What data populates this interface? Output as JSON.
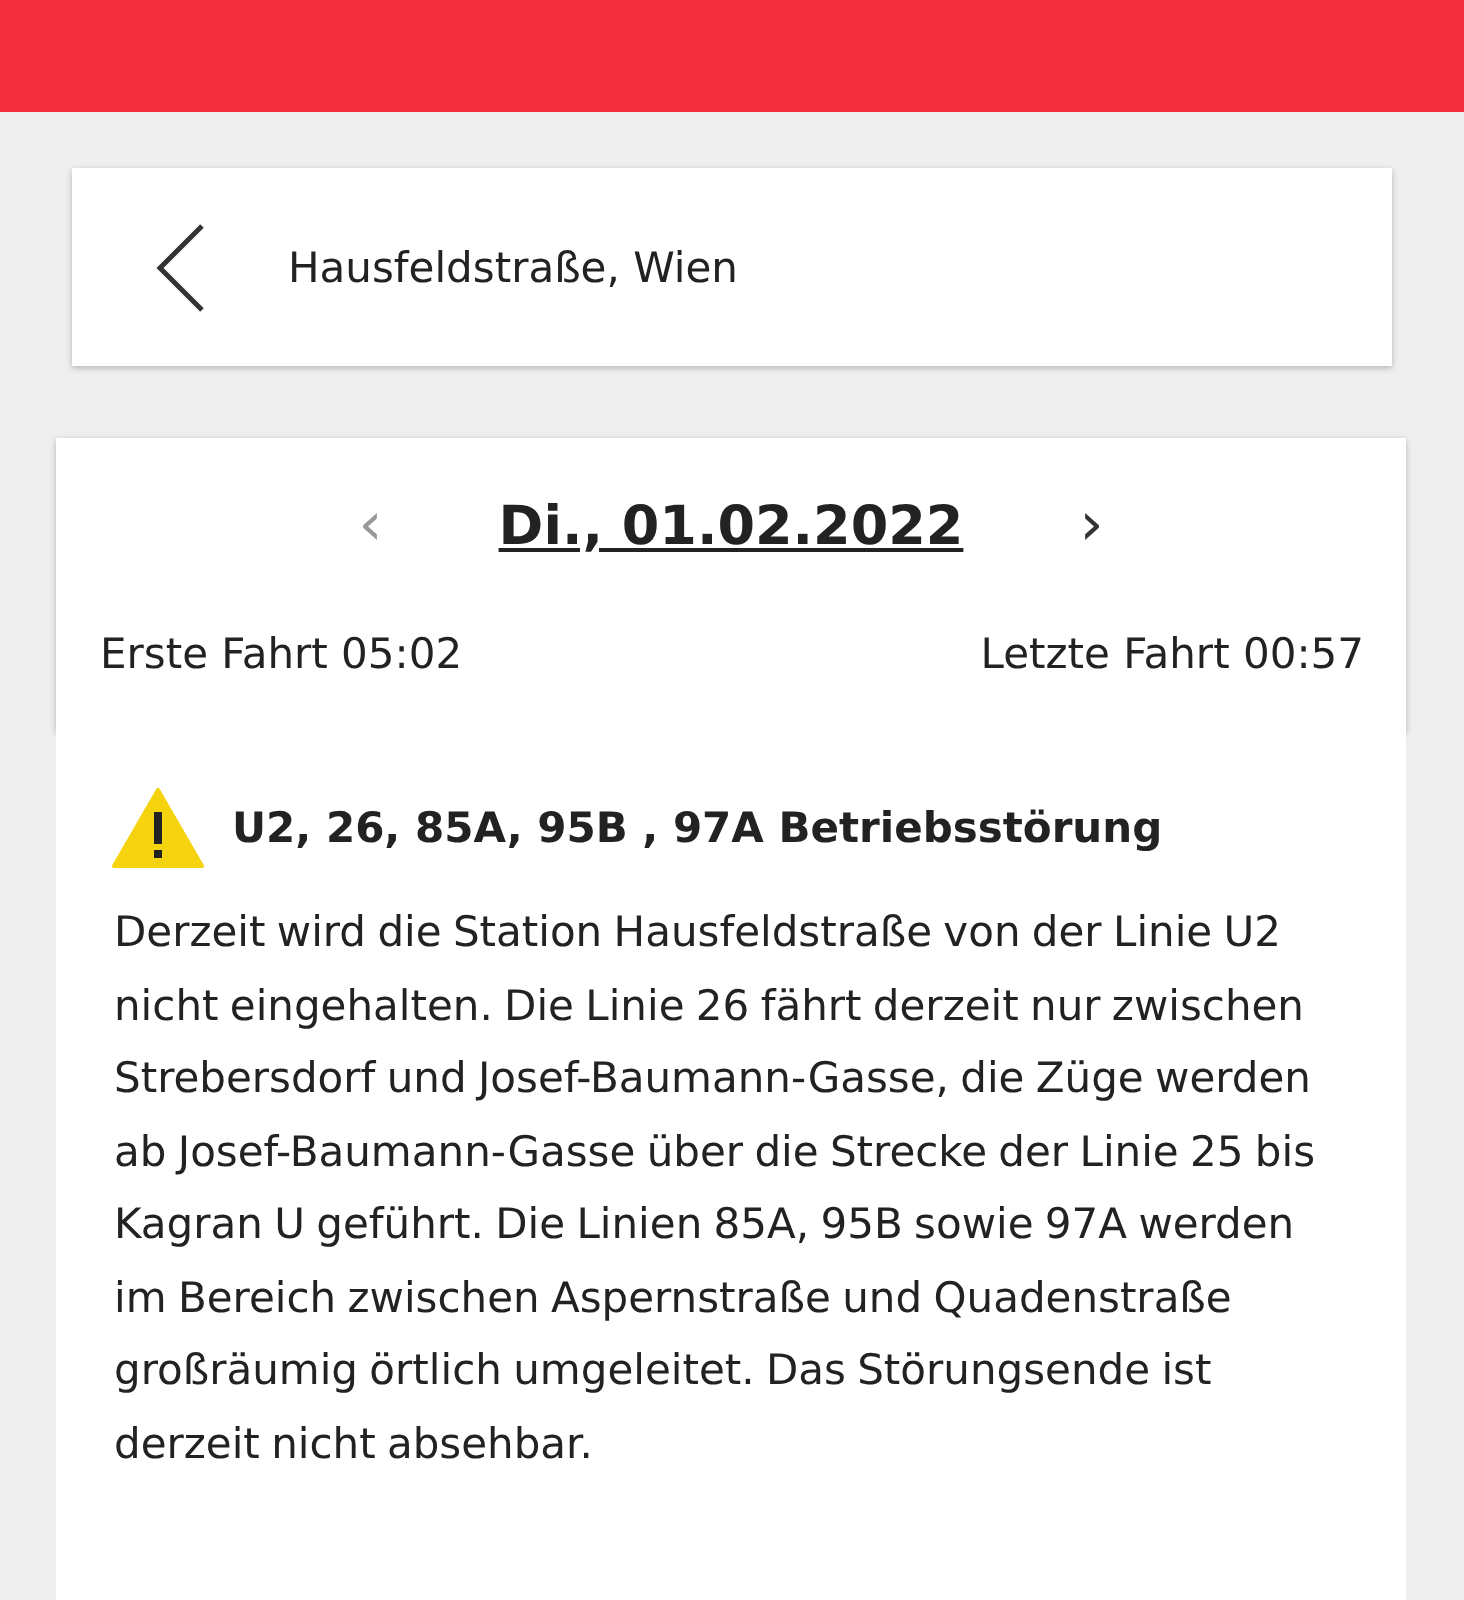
{
  "search": {
    "value": "Hausfeldstraße, Wien"
  },
  "date_nav": {
    "prev": "‹",
    "date": "Di., 01.02.2022",
    "next": "›",
    "first_trip": "Erste Fahrt 05:02",
    "last_trip": "Letzte Fahrt 00:57"
  },
  "alert": {
    "title": "U2, 26, 85A, 95B , 97A Betriebsstörung",
    "body": "Derzeit wird die Station Hausfeldstraße von der Linie U2 nicht eingehalten. Die Linie 26 fährt derzeit nur zwischen Strebersdorf und Josef-Baumann-Gasse, die Züge werden ab Josef-Baumann-Gasse über die Strecke der Linie 25 bis Kagran U geführt. Die Linien 85A, 95B sowie 97A werden im Bereich zwischen Aspernstraße und Quadenstraße großräumig örtlich umgeleitet. Das Störungsende ist derzeit nicht absehbar."
  }
}
